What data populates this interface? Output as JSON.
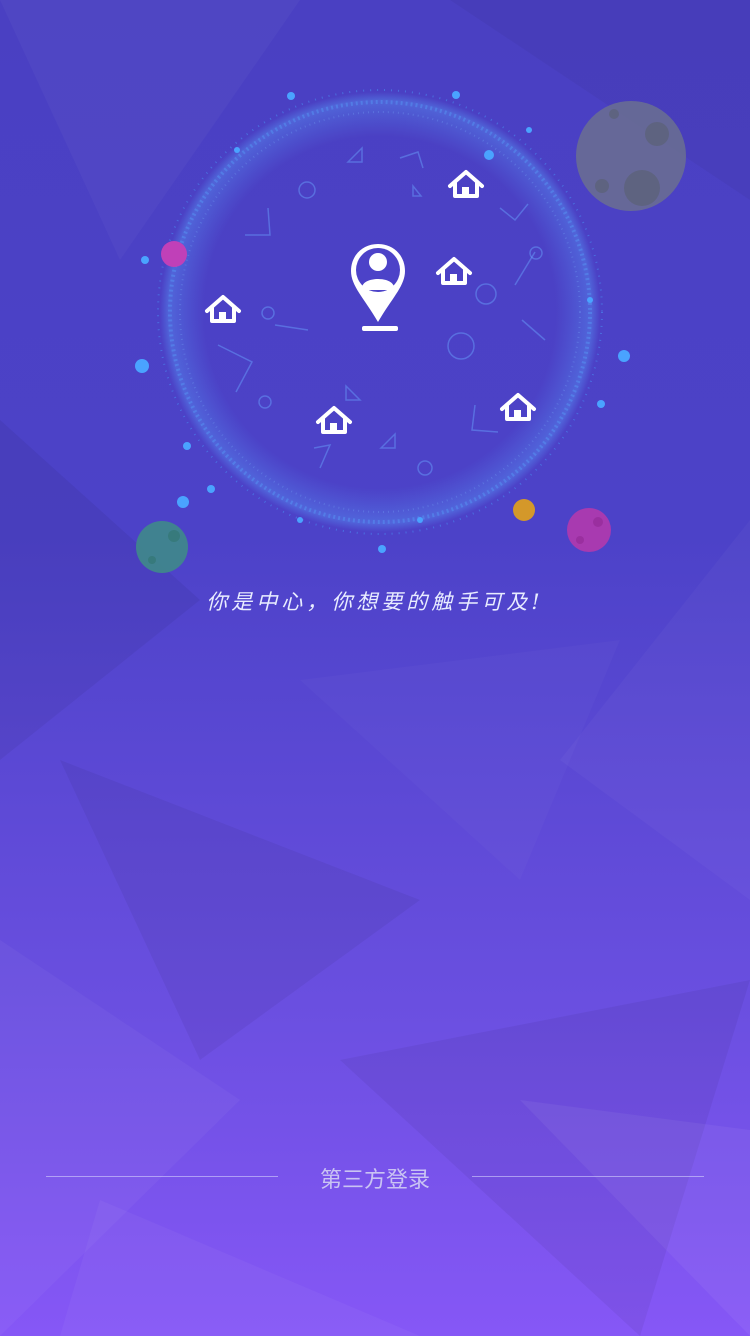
{
  "hero": {
    "slogan": "你是中心，你想要的触手可及!",
    "center_icon": "person-location-pin-icon",
    "place_icon": "home-icon",
    "place_count": 5
  },
  "login": {
    "third_party_label": "第三方登录"
  },
  "colors": {
    "background_top": "#4a40c2",
    "background_bottom": "#8657f6",
    "orbit_dots": "#4aa3ff",
    "planet_gray": "#6b7090",
    "planet_magenta": "#b040b8",
    "planet_teal": "#3f8a8a",
    "planet_orange": "#d4982a"
  }
}
